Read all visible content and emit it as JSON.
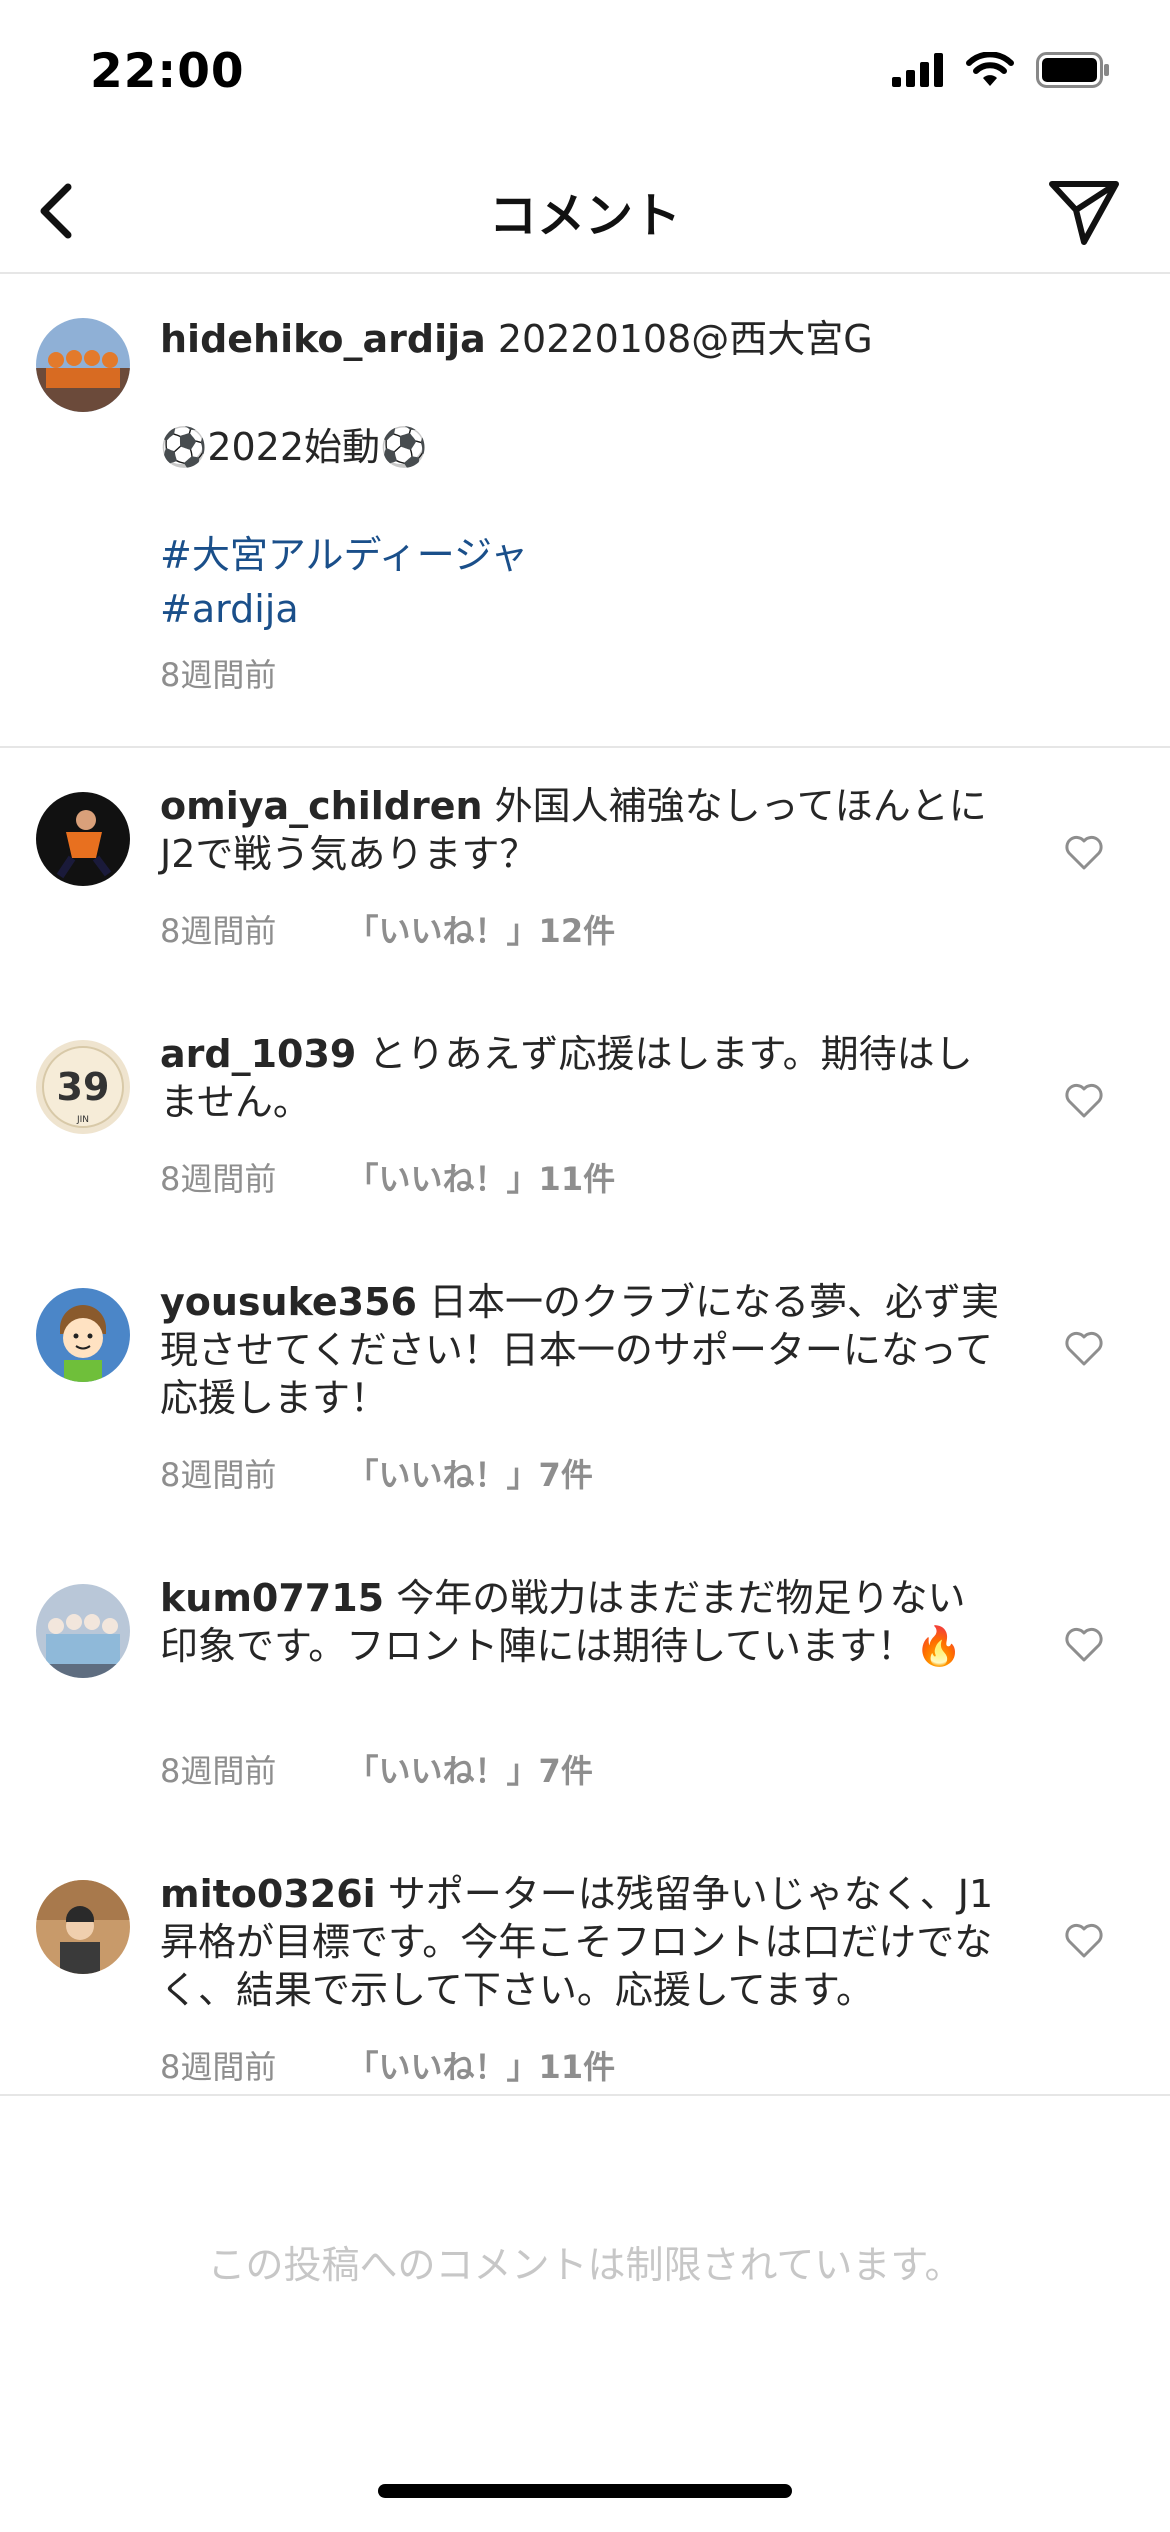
{
  "status_bar": {
    "time": "22:00"
  },
  "nav": {
    "title": "コメント"
  },
  "caption": {
    "username": "hidehiko_ardija",
    "text_line1": "20220108@西大宮G",
    "text_line2": "⚽2022始動⚽",
    "hashtags": [
      "#大宮アルディージャ",
      "#ardija"
    ],
    "time": "8週間前"
  },
  "comments": [
    {
      "username": "omiya_children",
      "text": "外国人補強なしってほんとにJ2で戦う気あります？",
      "time": "8週間前",
      "likes": "「いいね！」12件"
    },
    {
      "username": "ard_1039",
      "text": "とりあえず応援はします。期待はしません。",
      "time": "8週間前",
      "likes": "「いいね！」11件"
    },
    {
      "username": "yousuke356",
      "text": "日本一のクラブになる夢、必ず実現させてください！日本一のサポーターになって応援します！",
      "time": "8週間前",
      "likes": "「いいね！」7件"
    },
    {
      "username": "kum07715",
      "text": "今年の戦力はまだまだ物足りない印象です。フロント陣には期待しています！🔥",
      "time": "8週間前",
      "likes": "「いいね！」7件"
    },
    {
      "username": "mito0326i",
      "text": "サポーターは残留争いじゃなく、J1昇格が目標です。今年こそフロントは口だけでなく、結果で示して下さい。応援してます。",
      "time": "8週間前",
      "likes": "「いいね！」11件"
    }
  ],
  "footer": {
    "restricted_message": "この投稿へのコメントは制限されています。"
  },
  "icons": {
    "back": "chevron-left-icon",
    "send": "paper-plane-icon",
    "like": "heart-outline-icon"
  },
  "colors": {
    "hashtag": "#1a4f8a",
    "meta": "#8e8e8e",
    "muted": "#c7c7c7"
  }
}
